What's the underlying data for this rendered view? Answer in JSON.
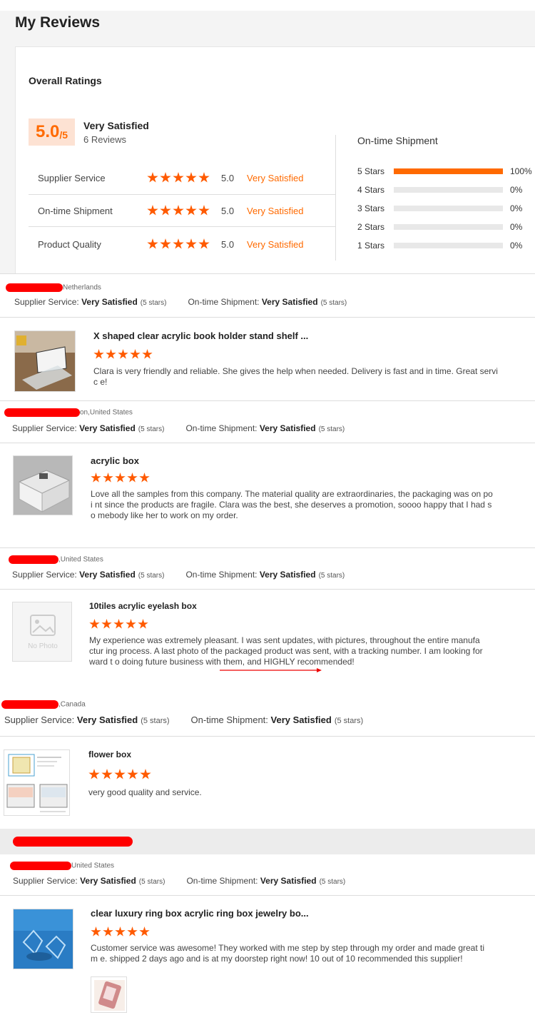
{
  "page_title": "My Reviews",
  "overall": {
    "title": "Overall Ratings",
    "score": "5.0",
    "score_max": "/5",
    "label": "Very Satisfied",
    "review_count": "6 Reviews",
    "categories": [
      {
        "name": "Supplier Service",
        "score": "5.0",
        "label": "Very Satisfied",
        "stars": 5
      },
      {
        "name": "On-time Shipment",
        "score": "5.0",
        "label": "Very Satisfied",
        "stars": 5
      },
      {
        "name": "Product Quality",
        "score": "5.0",
        "label": "Very Satisfied",
        "stars": 5
      }
    ],
    "distribution_title": "On-time Shipment",
    "distribution": [
      {
        "label": "5 Stars",
        "pct": "100%",
        "value": 1.0
      },
      {
        "label": "4 Stars",
        "pct": "0%",
        "value": 0
      },
      {
        "label": "3 Stars",
        "pct": "0%",
        "value": 0
      },
      {
        "label": "2 Stars",
        "pct": "0%",
        "value": 0
      },
      {
        "label": "1 Stars",
        "pct": "0%",
        "value": 0
      }
    ]
  },
  "meta_labels": {
    "supplier_service": "Supplier Service:",
    "on_time_shipment": "On-time Shipment:",
    "very_satisfied": "Very Satisfied",
    "five_stars": "(5 stars)"
  },
  "reviews": [
    {
      "location": "Netherlands",
      "product": "X shaped clear acrylic book holder stand shelf ...",
      "text": "Clara is very friendly and reliable. She gives the help when needed. Delivery is fast and in time. Great servic e!"
    },
    {
      "location": "on,United States",
      "product": "acrylic box",
      "text": "Love all the samples from this company. The material quality are extraordinaries, the packaging was on poi nt since the products are fragile. Clara was the best, she deserves a promotion, soooo happy that I had so mebody like her to work on my order."
    },
    {
      "location": ",United States",
      "product": "10tiles acrylic eyelash box",
      "no_photo": "No Photo",
      "text": "My experience was extremely pleasant. I was sent updates, with pictures, throughout the entire manufactur ing process. A last photo of the packaged product was sent, with a tracking number. I am looking forward t o doing future business with them, and HIGHLY recommended!"
    },
    {
      "location": ",Canada",
      "product": "flower box",
      "text": "very good quality and service."
    },
    {
      "location": "United States",
      "product": "clear luxury ring box acrylic ring box jewelry bo...",
      "text": "Customer service was awesome! They worked with me step by step through my order and made great tim e. shipped 2 days ago and is at my doorstep right now! 10 out of 10 recommended this supplier!"
    }
  ],
  "colors": {
    "accent": "#ff6a00",
    "star": "#ff5a00",
    "redaction": "#ff0000"
  }
}
